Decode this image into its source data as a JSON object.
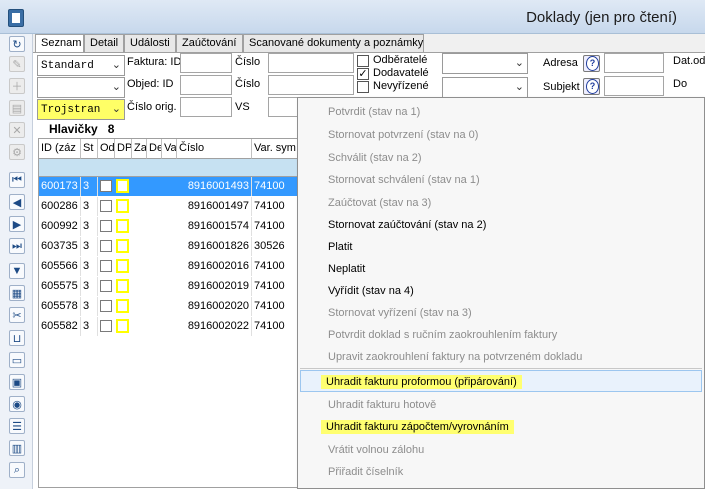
{
  "window": {
    "title": "Doklady (jen pro čtení)"
  },
  "tabs": [
    "Seznam",
    "Detail",
    "Události",
    "Zaúčtování",
    "Scanované dokumenty a poznámky"
  ],
  "filters": {
    "select1": "Standard",
    "select2": "",
    "select3": "Trojstran",
    "faktura_id_label": "Faktura: ID",
    "objed_id_label": "Objed: ID",
    "cislo_orig_label": "Číslo orig.",
    "cislo_label_1": "Číslo",
    "cislo_label_2": "Číslo",
    "vs_label": "VS",
    "odberatele": "Odběratelé",
    "dodavatele": "Dodavatelé",
    "nevyrizene": "Nevyřízené",
    "adresa_label": "Adresa",
    "subjekt_label": "Subjekt",
    "datod_label": "Dat.od",
    "do_label": "Do"
  },
  "grid": {
    "title": "Hlavičky",
    "count": "8",
    "columns": [
      "ID (záz",
      "St",
      "Od",
      "DP",
      "Za",
      "De",
      "Va",
      "Číslo",
      "Var. sym"
    ],
    "rows": [
      {
        "id": "600173",
        "st": "3",
        "cislo": "8916001493",
        "vs": "74100",
        "selected": true
      },
      {
        "id": "600286",
        "st": "3",
        "cislo": "8916001497",
        "vs": "74100",
        "selected": false
      },
      {
        "id": "600992",
        "st": "3",
        "cislo": "8916001574",
        "vs": "74100",
        "selected": false
      },
      {
        "id": "603735",
        "st": "3",
        "cislo": "8916001826",
        "vs": "30526",
        "selected": false
      },
      {
        "id": "605566",
        "st": "3",
        "cislo": "8916002016",
        "vs": "74100",
        "selected": false
      },
      {
        "id": "605575",
        "st": "3",
        "cislo": "8916002019",
        "vs": "74100",
        "selected": false
      },
      {
        "id": "605578",
        "st": "3",
        "cislo": "8916002020",
        "vs": "74100",
        "selected": false
      },
      {
        "id": "605582",
        "st": "3",
        "cislo": "8916002022",
        "vs": "74100",
        "selected": false
      }
    ]
  },
  "context_menu": {
    "items": [
      {
        "label": "Potvrdit  (stav na 1)",
        "enabled": false
      },
      {
        "label": "Stornovat potvrzení  (stav na 0)",
        "enabled": false
      },
      {
        "label": "Schválit  (stav na 2)",
        "enabled": false
      },
      {
        "label": "Stornovat schválení  (stav na 1)",
        "enabled": false
      },
      {
        "label": "Zaúčtovat  (stav na 3)",
        "enabled": false
      },
      {
        "label": "Stornovat zaúčtování  (stav na 2)",
        "enabled": true
      },
      {
        "label": "Platit",
        "enabled": true
      },
      {
        "label": "Neplatit",
        "enabled": true
      },
      {
        "label": "Vyřídit  (stav na 4)",
        "enabled": true
      },
      {
        "label": "Stornovat vyřízení  (stav na 3)",
        "enabled": false
      },
      {
        "label": "Potvrdit doklad s ručním zaokrouhlením faktury",
        "enabled": false
      },
      {
        "label": "Upravit zaokrouhlení faktury na potvrzeném dokladu",
        "enabled": false
      },
      {
        "label": "Uhradit fakturu proformou (připárování)",
        "enabled": true,
        "highlight": true
      },
      {
        "label": "Uhradit fakturu hotově",
        "enabled": false
      },
      {
        "label": "Uhradit fakturu zápočtem/vyrovnáním",
        "enabled": true,
        "highlight": true
      },
      {
        "label": "Vrátit volnou zálohu",
        "enabled": false
      },
      {
        "label": "Přiřadit číselník",
        "enabled": false
      }
    ]
  },
  "colors": {
    "highlight": "#ffff70",
    "selection": "#3399ff",
    "filter_row": "#c6e1f2"
  }
}
